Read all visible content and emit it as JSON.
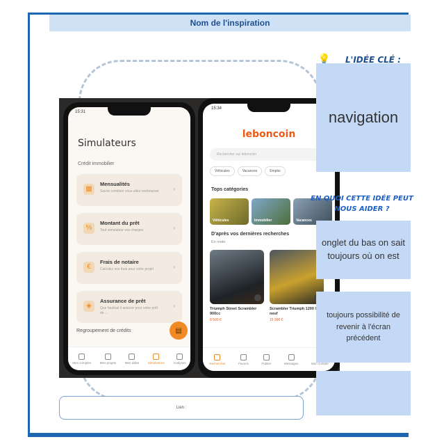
{
  "page": {
    "title": "Nom de l'inspiration",
    "key_idea_label": "L'IDÉE CLÉ :",
    "key_idea": "navigation",
    "help_question": "EN QUOI CETTE IDÉE PEUT NOUS AIDER ?",
    "benefit_1": "onglet du bas on sait toujours où on est",
    "benefit_2": "toujours possibilité de revenir à l'écran précédent",
    "link_label": "Lien :"
  },
  "phone_left": {
    "time": "15:31",
    "title": "Simulateurs",
    "section": "Crédit immobilier",
    "cards": [
      {
        "title": "Mensualités",
        "desc": "Savoir combien vous allez rembourser",
        "icon": "calendar-icon"
      },
      {
        "title": "Montant du prêt",
        "desc": "Tout simulateur vos charges",
        "icon": "percent-icon"
      },
      {
        "title": "Frais de notaire",
        "desc": "Calculez vos frais pour votre projet",
        "icon": "euro-icon"
      },
      {
        "title": "Assurance de prêt",
        "desc": "Que faudrait il assurer pour votre prêt de ...",
        "icon": "shield-icon"
      }
    ],
    "footer": "Regroupement de crédits",
    "tabs": [
      "Mes comptes",
      "Mes projets",
      "Mes aides",
      "Simulateurs",
      "Analyses"
    ]
  },
  "phone_right": {
    "time": "15:34",
    "logo": "leboncoin",
    "search_placeholder": "Rechercher sur leboncoin",
    "chips": [
      "Véhicules",
      "Vacances",
      "Emploi"
    ],
    "top_categories": "Tops catégories",
    "categories": [
      "Véhicules",
      "Immobilier",
      "Vacances"
    ],
    "recent_searches": "D'après vos dernières recherches",
    "recent_sub": "En moto",
    "listings": [
      {
        "title": "Triumph Street Scrambler 900cc",
        "price": "8 500 €"
      },
      {
        "title": "Scrambler Triumph 1200 Xe neuf",
        "price": "15 990 €"
      }
    ],
    "tabs": [
      "Rechercher",
      "Favoris",
      "Publier",
      "Messages",
      "Mon compte"
    ]
  },
  "colors": {
    "accent": "#1d67b0",
    "title_bg": "#cfe2f5",
    "card_bg": "#c4d9f6",
    "leboncoin": "#ec5a13",
    "simulateur_orange": "#f08a24"
  }
}
